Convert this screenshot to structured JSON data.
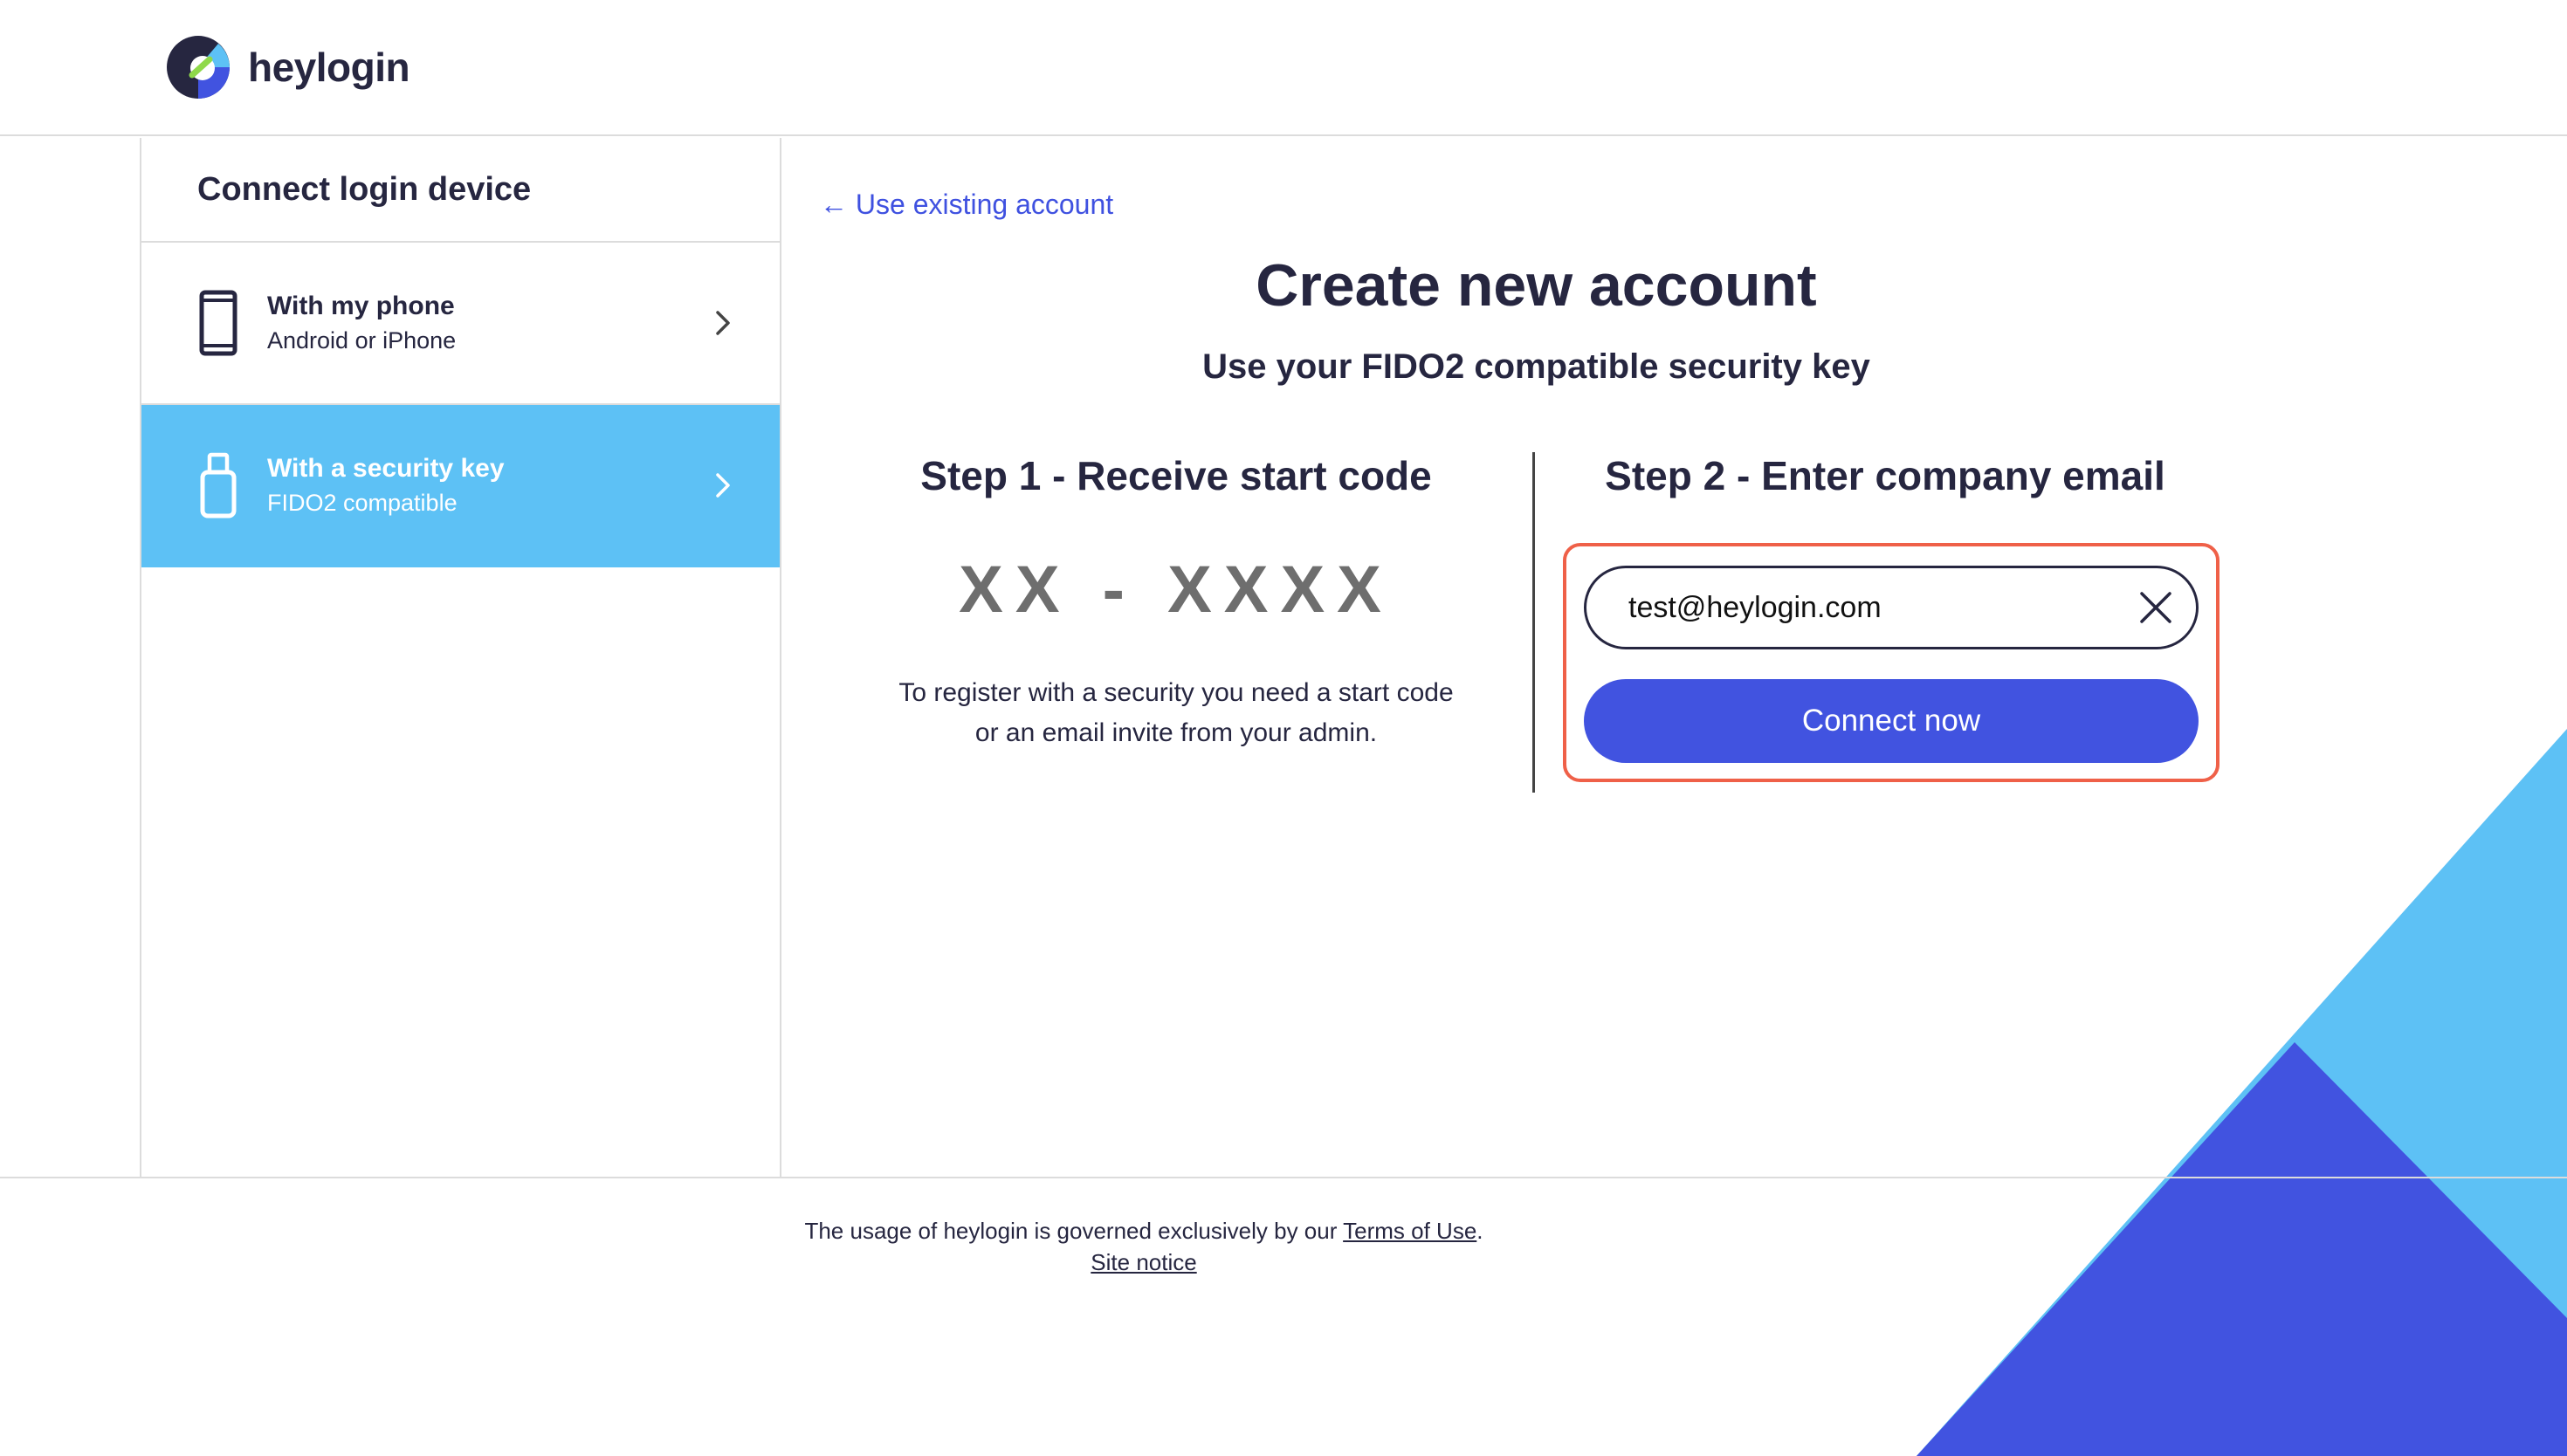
{
  "brand": {
    "name": "heylogin"
  },
  "sidebar": {
    "title": "Connect login device",
    "items": [
      {
        "title": "With my phone",
        "subtitle": "Android or iPhone",
        "icon": "phone-icon",
        "active": false
      },
      {
        "title": "With a security key",
        "subtitle": "FIDO2 compatible",
        "icon": "usb-key-icon",
        "active": true
      }
    ]
  },
  "main": {
    "back_link": "← Use existing account",
    "heading": "Create new account",
    "subheading": "Use your FIDO2 compatible security key",
    "step1": {
      "title": "Step 1 - Receive start code",
      "code_placeholder": "XX - XXXX",
      "description_line1": "To register with a security you need a start code",
      "description_line2": "or an email invite from your admin."
    },
    "step2": {
      "title": "Step 2 - Enter company email",
      "email_value": "test@heylogin.com",
      "button_label": "Connect now"
    }
  },
  "footer": {
    "text_before": "The usage of heylogin is governed exclusively by our ",
    "terms_link": "Terms of Use",
    "text_after": ".",
    "site_notice": "Site notice"
  },
  "colors": {
    "primary": "#4153e0",
    "accent": "#5dc1f5",
    "highlight": "#ef6048",
    "text": "#262640"
  }
}
